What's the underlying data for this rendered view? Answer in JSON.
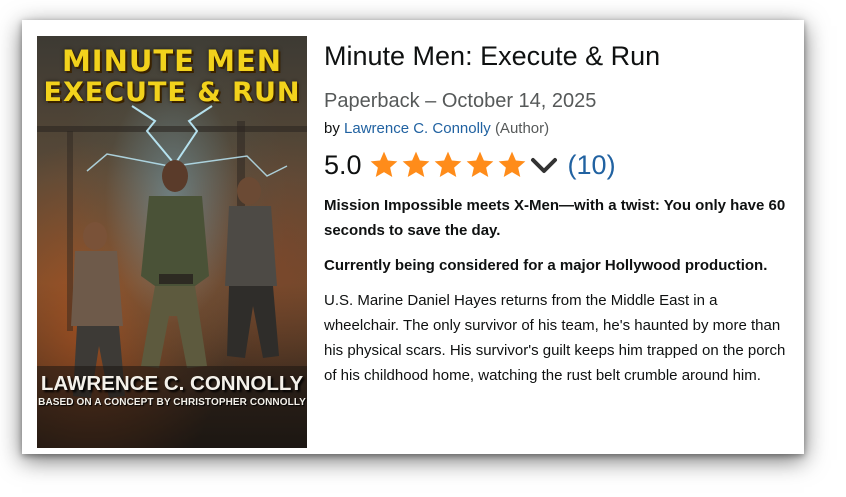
{
  "cover": {
    "title_line1": "MINUTE MEN",
    "title_line2": "EXECUTE & RUN",
    "author": "LAWRENCE C. CONNOLLY",
    "concept": "BASED ON A CONCEPT BY CHRISTOPHER CONNOLLY"
  },
  "product": {
    "title": "Minute Men: Execute & Run",
    "format": "Paperback – October 14, 2025",
    "by_prefix": "by",
    "author": "Lawrence C. Connolly",
    "author_role": "(Author)"
  },
  "rating": {
    "value": "5.0",
    "stars": 5,
    "count": "(10)",
    "star_color": "#ff8c1a",
    "icon": "chevron-down-icon"
  },
  "description": {
    "tagline": "Mission Impossible meets X-Men—with a twist: You only have 60 seconds to save the day.",
    "hollywood": "Currently being considered for a major Hollywood production.",
    "body": "U.S. Marine Daniel Hayes returns from the Middle East in a wheelchair. The only survivor of his team, he's haunted by more than his physical scars. His survivor's guilt keeps him trapped on the porch of his childhood home, watching the rust belt crumble around him."
  },
  "colors": {
    "link": "#2162a1",
    "text": "#0f1111",
    "muted": "#565959",
    "cover_title": "#f2d21c"
  }
}
